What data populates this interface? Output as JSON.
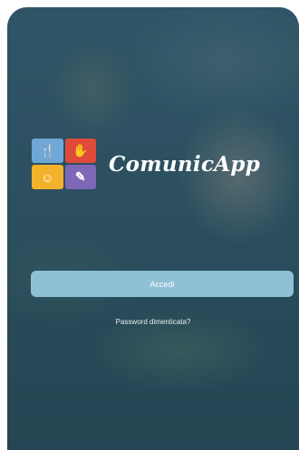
{
  "app": {
    "name": "ComunicApp"
  },
  "logo": {
    "tiles": [
      {
        "icon": "fork-knife-icon",
        "glyph": "🍴",
        "color": "#6ea7d8"
      },
      {
        "icon": "hand-icon",
        "glyph": "✋",
        "color": "#e04a3a"
      },
      {
        "icon": "smile-icon",
        "glyph": "☺",
        "color": "#f3b22a"
      },
      {
        "icon": "pencil-icon",
        "glyph": "✎",
        "color": "#7d68b8"
      }
    ]
  },
  "login": {
    "button_label": "Accedi",
    "forgot_password_label": "Password dimenticata?"
  },
  "colors": {
    "button": "#8fc0d6",
    "overlay": "#204658"
  }
}
